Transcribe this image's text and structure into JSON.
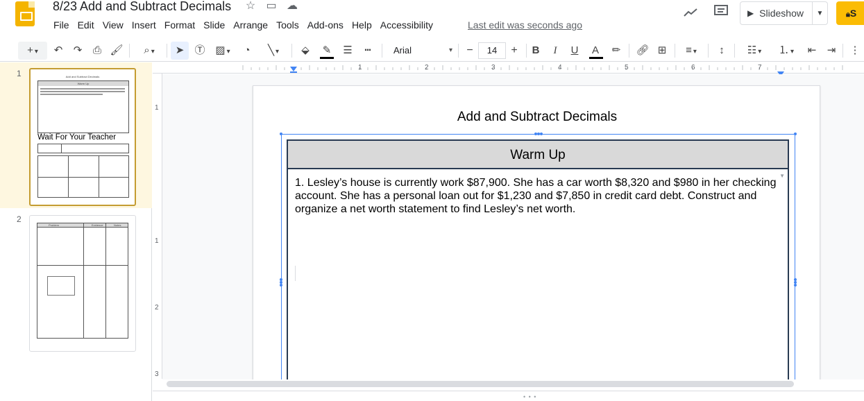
{
  "app": {
    "doc_title": "8/23 Add and Subtract Decimals",
    "last_edit": "Last edit was seconds ago",
    "slideshow_label": "Slideshow",
    "share_label": "S"
  },
  "menu": [
    "File",
    "Edit",
    "View",
    "Insert",
    "Format",
    "Slide",
    "Arrange",
    "Tools",
    "Add-ons",
    "Help",
    "Accessibility"
  ],
  "toolbar": {
    "font": "Arial",
    "font_size": "14",
    "minus": "−",
    "plus": "+"
  },
  "ruler": {
    "h_numbers": [
      "1",
      "2",
      "3",
      "4",
      "5",
      "6",
      "7"
    ],
    "v_numbers": [
      "1",
      "1",
      "2",
      "3"
    ]
  },
  "filmstrip": {
    "slide1_number": "1",
    "slide2_number": "2",
    "thumb1_title": "Add and Subtract Decimals",
    "thumb1_head": "Warm Up",
    "thumb1_wait": "Wait For Your Teacher",
    "thumb2_cols": [
      "Problem",
      "Evidence",
      "Notes"
    ]
  },
  "slide": {
    "title": "Add and Subtract Decimals",
    "table_header": "Warm Up",
    "table_text": "1. Lesley’s house is currently work $87,900. She has a car worth $8,320 and $980 in her checking account. She has a personal loan out for $1,230 and $7,850 in credit card debt. Construct and organize a net worth statement to find Lesley’s net worth."
  }
}
